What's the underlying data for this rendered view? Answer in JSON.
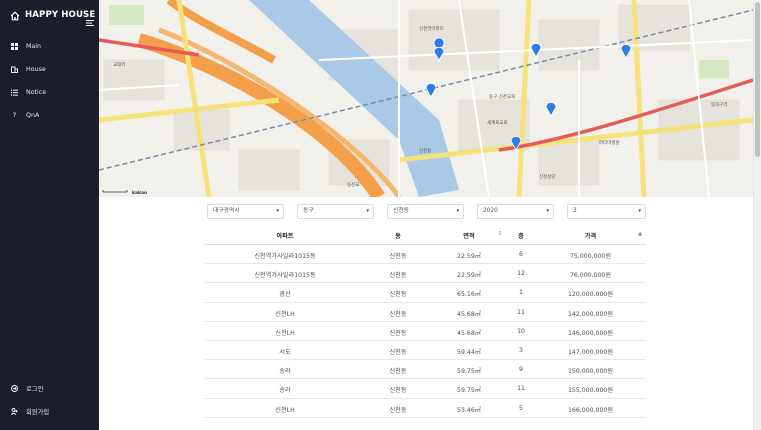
{
  "app": {
    "title": "HAPPY HOUSE",
    "brand_icon": "home-icon",
    "menu_icon": "hamburger-icon"
  },
  "sidebar": {
    "items": [
      {
        "label": "Main",
        "icon": "grid-icon"
      },
      {
        "label": "House",
        "icon": "building-icon"
      },
      {
        "label": "Notice",
        "icon": "list-icon"
      },
      {
        "label": "QnA",
        "icon": "question-icon"
      }
    ],
    "bottom_items": [
      {
        "label": "로그인",
        "icon": "login-icon"
      },
      {
        "label": "회원가입",
        "icon": "user-add-icon"
      }
    ]
  },
  "map": {
    "attribution": "kakao",
    "labels": {
      "station_left": "교대역",
      "area_mid": "세계로교회",
      "cross": "신천동",
      "apt1": "신천역아파트",
      "apt2": "동구 신천교회",
      "sigijang": "동대구역",
      "bridge": "동신교",
      "hospital": "파티마병원",
      "church": "신천성당"
    },
    "marker_color": "#2b7de9"
  },
  "filters": {
    "city": "대구광역시",
    "district": "동구",
    "dong": "신천동",
    "year": "2020",
    "month": "3"
  },
  "table": {
    "headers": {
      "apartment": "아파트",
      "dong": "동",
      "area": "면적",
      "floor": "층",
      "price": "가격"
    },
    "rows": [
      {
        "apartment": "신천역가사일라1015동",
        "dong": "신천동",
        "area": "22.59㎡",
        "floor": "6",
        "price": "75,000,000원"
      },
      {
        "apartment": "신천역가사일라1015동",
        "dong": "신천동",
        "area": "22.59㎡",
        "floor": "12",
        "price": "76,000,000원"
      },
      {
        "apartment": "광산",
        "dong": "신천동",
        "area": "65.16㎡",
        "floor": "1",
        "price": "120,000,000원"
      },
      {
        "apartment": "신천LH",
        "dong": "신천동",
        "area": "45.68㎡",
        "floor": "11",
        "price": "142,000,000원"
      },
      {
        "apartment": "신천LH",
        "dong": "신천동",
        "area": "45.68㎡",
        "floor": "10",
        "price": "146,000,000원"
      },
      {
        "apartment": "서도",
        "dong": "신천동",
        "area": "59.44㎡",
        "floor": "3",
        "price": "147,000,000원"
      },
      {
        "apartment": "송라",
        "dong": "신천동",
        "area": "59.75㎡",
        "floor": "9",
        "price": "150,000,000원"
      },
      {
        "apartment": "송라",
        "dong": "신천동",
        "area": "59.75㎡",
        "floor": "11",
        "price": "155,000,000원"
      },
      {
        "apartment": "신천LH",
        "dong": "신천동",
        "area": "53.46㎡",
        "floor": "5",
        "price": "166,000,000원"
      }
    ]
  }
}
